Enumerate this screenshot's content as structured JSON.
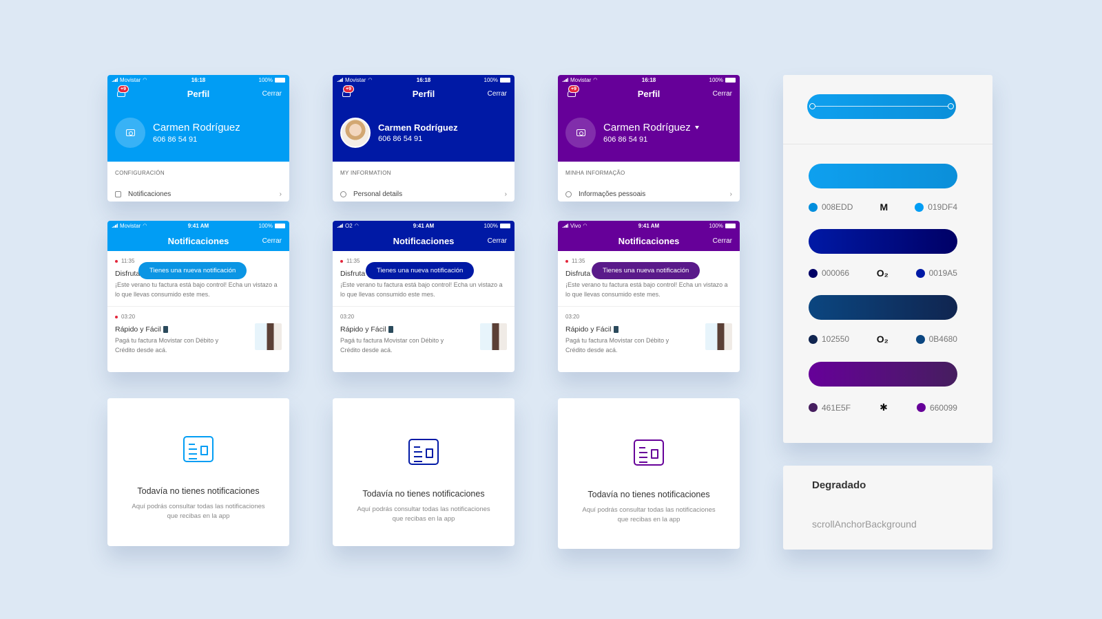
{
  "profiles": [
    {
      "color": "#019DF4",
      "carrier": "Movistar",
      "time": "16:18",
      "battery": "100%",
      "badge": "+9",
      "title": "Perfil",
      "close": "Cerrar",
      "name": "Carmen Rodríguez",
      "phone": "606 86 54 91",
      "section": "CONFIGURACIÓN",
      "item": "Notificaciones"
    },
    {
      "color": "#0019A5",
      "carrier": "Movistar",
      "time": "16:18",
      "battery": "100%",
      "badge": "+9",
      "title": "Perfil",
      "close": "Cerrar",
      "name": "Carmen Rodríguez",
      "phone": "606 86 54 91",
      "section": "MY INFORMATION",
      "item": "Personal details"
    },
    {
      "color": "#660099",
      "carrier": "Movistar",
      "time": "16:18",
      "battery": "100%",
      "badge": "+9",
      "title": "Perfil",
      "close": "Cerrar",
      "name": "Carmen Rodríguez",
      "phone": "606 86 54 91",
      "section": "MINHA INFORMAÇÃO",
      "item": "Informações pessoais"
    }
  ],
  "notifications": [
    {
      "color": "#019DF4",
      "toast_color": "#0b95e4",
      "carrier": "Movistar",
      "time": "9:41 AM",
      "battery": "100%",
      "title": "Notificaciones",
      "close": "Cerrar",
      "toast": "Tienes una nueva notificación",
      "item1": {
        "time": "11:35",
        "title": "Disfruta",
        "text": "¡Este verano tu factura está bajo control! Echa un vistazo a lo que llevas consumido este mes."
      },
      "item2": {
        "time": "03:20",
        "title": "Rápido y Fácil",
        "text": "Pagá tu factura Movistar con Débito y Crédito desde acá."
      }
    },
    {
      "color": "#0019A5",
      "toast_color": "#0019A5",
      "carrier": "O2",
      "time": "9:41 AM",
      "battery": "100%",
      "title": "Notificaciones",
      "close": "Cerrar",
      "toast": "Tienes una nueva notificación",
      "item1": {
        "time": "11:35",
        "title": "Disfruta",
        "text": "¡Este verano tu factura está bajo control! Echa un vistazo a lo que llevas consumido este mes."
      },
      "item2": {
        "time": "03:20",
        "title": "Rápido y Fácil",
        "text": "Pagá tu factura Movistar con Débito y Crédito desde acá."
      }
    },
    {
      "color": "#660099",
      "toast_color": "#5a1a8a",
      "carrier": "Vivo",
      "time": "9:41 AM",
      "battery": "100%",
      "title": "Notificaciones",
      "close": "Cerrar",
      "toast": "Tienes una nueva notificación",
      "item1": {
        "time": "11:35",
        "title": "Disfruta",
        "text": "¡Este verano tu factura está bajo control! Echa un vistazo a lo que llevas consumido este mes."
      },
      "item2": {
        "time": "03:20",
        "title": "Rápido y Fácil",
        "text": "Pagá tu factura Movistar con Débito y Crédito desde acá."
      }
    }
  ],
  "empty_states": [
    {
      "color": "#019DF4",
      "title": "Todavía no tienes notificaciones",
      "text": "Aquí podrás consultar todas las notificaciones que recibas en la app"
    },
    {
      "color": "#0019A5",
      "title": "Todavía no tienes notificaciones",
      "text": "Aquí podrás consultar todas las notificaciones que recibas en la app"
    },
    {
      "color": "#660099",
      "title": "Todavía no tienes notificaciones",
      "text": "Aquí podrás consultar todas las notificaciones que recibas en la app"
    }
  ],
  "palette": [
    {
      "from": "#008EDD",
      "to": "#019DF4",
      "left_hex": "008EDD",
      "right_hex": "019DF4",
      "left_color": "#008EDD",
      "right_color": "#019DF4",
      "brand": "M",
      "brand_icon": "movistar-logo-icon"
    },
    {
      "from": "#0019A5",
      "to": "#000066",
      "left_hex": "000066",
      "right_hex": "0019A5",
      "left_color": "#000066",
      "right_color": "#0019A5",
      "brand": "O₂",
      "brand_icon": "o2-logo-icon"
    },
    {
      "from": "#0B4680",
      "to": "#102550",
      "left_hex": "102550",
      "right_hex": "0B4680",
      "left_color": "#102550",
      "right_color": "#0B4680",
      "brand": "O₂",
      "brand_icon": "o2-logo-icon"
    },
    {
      "from": "#660099",
      "to": "#461E5F",
      "left_hex": "461E5F",
      "right_hex": "660099",
      "left_color": "#461E5F",
      "right_color": "#660099",
      "brand": "✱",
      "brand_icon": "vivo-logo-icon"
    }
  ],
  "gradient_panel": {
    "title": "Degradado",
    "token": "scrollAnchorBackground"
  }
}
